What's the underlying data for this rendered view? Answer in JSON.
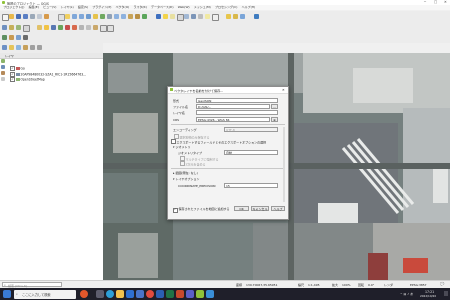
{
  "window": {
    "title": "無題のプロジェクト — QGIS",
    "controls": [
      "─",
      "□",
      "✕"
    ]
  },
  "menu": [
    "プロジェクト(J)",
    "編集(E)",
    "ビュー(V)",
    "レイヤ(L)",
    "設定(S)",
    "プラグイン(P)",
    "ベクタ(O)",
    "ラスタ(R)",
    "データベース(D)",
    "Web(W)",
    "メッシュ(M)",
    "プロセシング(C)",
    "ヘルプ(H)"
  ],
  "layers_panel": {
    "title": "レイヤ",
    "layers": [
      {
        "name": "Go",
        "checked": true
      },
      {
        "name": "20AP98480032-SZA1_RIC1-1R15664763...",
        "checked": true
      },
      {
        "name": "OpenStreetMap",
        "checked": true
      }
    ]
  },
  "dialog": {
    "title": "ベクタレイヤを名前を付けて保存...",
    "format_label": "形式",
    "format_value": "GeoJSON",
    "filename_label": "ファイル名",
    "filename_value": "D:/GIS/...",
    "layername_label": "レイヤ名",
    "crs_label": "CRS",
    "crs_value": "EPSG:4326 - WGS 84",
    "encoding_label": "エンコーディング",
    "encoding_value": "UTF-8",
    "selected_only_label": "選択地物のみ保存する",
    "fields_label": "エクスポートするフィールドとそのエクスポートオプションの選択",
    "symbology_section": "▾ ジオメトリ",
    "geometry_type_label": "ジオメトリタイプ",
    "geometry_type_value": "自動",
    "multitype_label": "マルチタイプに強制する",
    "z_label": "Z次元を含める",
    "extent_section": "▸ 範囲(現在: なし)",
    "layer_options_section": "▾ レイヤオプション",
    "precision_label": "COORDINATE_PRECISION",
    "precision_value": "15",
    "add_to_map_label": "保存されたファイルを地図に追加する",
    "ok_label": "OK",
    "cancel_label": "キャンセル",
    "help_label": "ヘルプ"
  },
  "statusbar": {
    "search_placeholder": "検索 (Ctrl+K)",
    "coord_label": "座標",
    "coord_value": "139.70067,35.65951",
    "scale_label": "縮尺",
    "scale_value": "1:1,495",
    "magnifier_label": "拡大",
    "magnifier_value": "100%",
    "rotation_label": "回転",
    "rotation_value": "0.0°",
    "render_label": "レンダ",
    "crs_value": "EPSG:3857"
  },
  "taskbar": {
    "search_text": "ここに入力して検索",
    "time": "17:21",
    "date": "2022/10/20"
  }
}
